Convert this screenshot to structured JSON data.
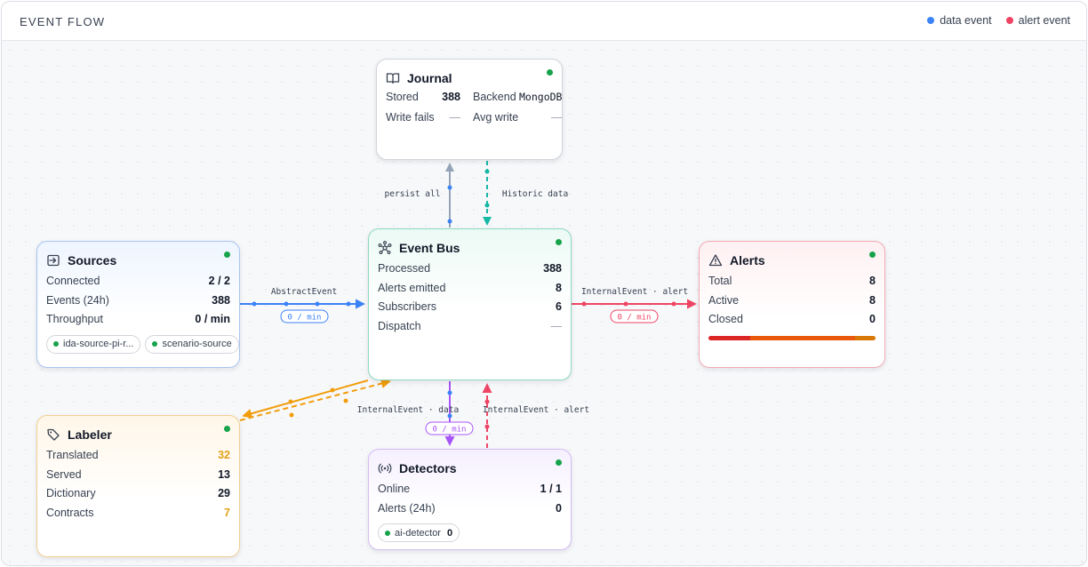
{
  "header": {
    "title": "EVENT FLOW",
    "legend": [
      {
        "label": "data event",
        "color": "#3b82f6"
      },
      {
        "label": "alert event",
        "color": "#ef4565"
      }
    ]
  },
  "colors": {
    "data": "#3b82f6",
    "alert": "#ef4565",
    "persist": "#94a3b8",
    "historic": "#14b8a6",
    "labeler": "#f29d0c",
    "detector": "#a855f7",
    "online": "#16a34a"
  },
  "edges": {
    "persist": {
      "label": "persist all"
    },
    "historic": {
      "label": "Historic data"
    },
    "abstract": {
      "label": "AbstractEvent",
      "rate": "0 / min"
    },
    "internal_alert_right": {
      "label": "InternalEvent · alert",
      "rate": "0 / min"
    },
    "internal_data_down": {
      "label": "InternalEvent · data",
      "rate": "0 / min"
    },
    "internal_alert_up": {
      "label": "InternalEvent · alert"
    }
  },
  "journal": {
    "title": "Journal",
    "icon": "book-icon",
    "stored_label": "Stored",
    "stored_value": "388",
    "backend_label": "Backend",
    "backend_value": "MongoDB",
    "write_fails_label": "Write fails",
    "write_fails_value": "—",
    "avg_write_label": "Avg write",
    "avg_write_value": "—"
  },
  "sources": {
    "title": "Sources",
    "icon": "source-import-icon",
    "rows": [
      {
        "label": "Connected",
        "value": "2 / 2"
      },
      {
        "label": "Events (24h)",
        "value": "388"
      },
      {
        "label": "Throughput",
        "value": "0 / min"
      }
    ],
    "chips": [
      "ida-source-pi-r...",
      "scenario-source"
    ]
  },
  "bus": {
    "title": "Event Bus",
    "icon": "network-hub-icon",
    "rows": [
      {
        "label": "Processed",
        "value": "388"
      },
      {
        "label": "Alerts emitted",
        "value": "8"
      },
      {
        "label": "Subscribers",
        "value": "6"
      },
      {
        "label": "Dispatch",
        "value": "—"
      }
    ]
  },
  "alerts": {
    "title": "Alerts",
    "icon": "warning-triangle-icon",
    "rows": [
      {
        "label": "Total",
        "value": "8"
      },
      {
        "label": "Active",
        "value": "8"
      },
      {
        "label": "Closed",
        "value": "0"
      }
    ],
    "severity_bar": [
      {
        "fraction": 0.25,
        "color": "#dc2626"
      },
      {
        "fraction": 0.63,
        "color": "#ea580c"
      },
      {
        "fraction": 0.12,
        "color": "#d97706"
      }
    ]
  },
  "labeler": {
    "title": "Labeler",
    "icon": "tag-icon",
    "rows": [
      {
        "label": "Translated",
        "value": "32"
      },
      {
        "label": "Served",
        "value": "13"
      },
      {
        "label": "Dictionary",
        "value": "29"
      },
      {
        "label": "Contracts",
        "value": "7"
      }
    ]
  },
  "detectors": {
    "title": "Detectors",
    "icon": "broadcast-icon",
    "rows": [
      {
        "label": "Online",
        "value": "1 / 1"
      },
      {
        "label": "Alerts (24h)",
        "value": "0"
      }
    ],
    "chip": {
      "label": "ai-detector",
      "count": "0"
    }
  }
}
